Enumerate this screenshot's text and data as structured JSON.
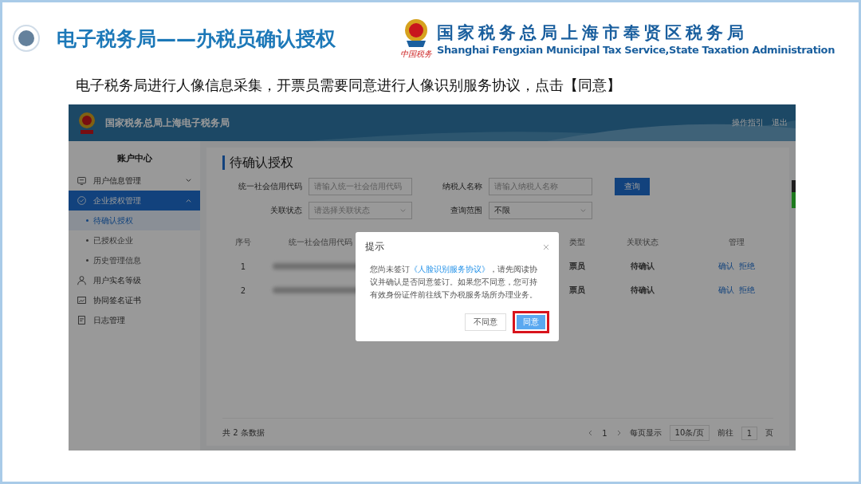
{
  "slide": {
    "title": "电子税务局——办税员确认授权",
    "org_name": "国家税务总局上海市奉贤区税务局",
    "org_name_en": "Shanghai Fengxian Municipal Tax Service,State Taxation Administration",
    "org_seal_text": "中国税务",
    "instruction": "电子税务局进行人像信息采集，开票员需要同意进行人像识别服务协议，点击【同意】"
  },
  "app": {
    "header": {
      "title": "国家税务总局上海电子税务局",
      "links": [
        "操作指引",
        "退出"
      ]
    },
    "sidebar": {
      "title": "账户中心",
      "items": [
        {
          "label": "用户信息管理",
          "kind": "group",
          "expanded": false,
          "selected": false
        },
        {
          "label": "企业授权管理",
          "kind": "group",
          "expanded": true,
          "selected": true,
          "children": [
            {
              "label": "待确认授权",
              "selected": true
            },
            {
              "label": "已授权企业",
              "selected": false
            },
            {
              "label": "历史管理信息",
              "selected": false
            }
          ]
        },
        {
          "label": "用户实名等级",
          "kind": "link",
          "selected": false
        },
        {
          "label": "协同签名证书",
          "kind": "link",
          "selected": false
        },
        {
          "label": "日志管理",
          "kind": "link",
          "selected": false
        }
      ]
    },
    "page": {
      "title": "待确认授权",
      "filters": [
        {
          "label": "统一社会信用代码",
          "kind": "input",
          "placeholder": "请输入统一社会信用代码"
        },
        {
          "label": "纳税人名称",
          "kind": "input",
          "placeholder": "请输入纳税人名称"
        },
        {
          "label": "关联状态",
          "kind": "select",
          "placeholder": "请选择关联状态"
        },
        {
          "label": "查询范围",
          "kind": "select",
          "value": "不限"
        }
      ],
      "query_button": "查询",
      "table": {
        "columns": [
          "序号",
          "统一社会信用代码",
          "类型",
          "关联状态",
          "管理"
        ],
        "rows": [
          {
            "index": "1",
            "type": "票员",
            "status": "待确认",
            "actions": [
              "确认",
              "拒绝"
            ]
          },
          {
            "index": "2",
            "type": "票员",
            "status": "待确认",
            "actions": [
              "确认",
              "拒绝"
            ]
          }
        ]
      },
      "footer": {
        "total": "共 2 条数据",
        "page": "1",
        "page_size_label": "每页显示",
        "page_size": "10条/页",
        "goto_label": "前往",
        "goto_value": "1",
        "goto_suffix": "页"
      }
    },
    "dialog": {
      "title": "提示",
      "body_before": "您尚未签订",
      "link": "《人脸识别服务协议》",
      "body_after": "，请先阅读协议并确认是否同意签订。如果您不同意，您可持有效身份证件前往线下办税服务场所办理业务。",
      "buttons": [
        {
          "label": "不同意",
          "kind": "secondary",
          "highlighted": false
        },
        {
          "label": "同意",
          "kind": "primary",
          "highlighted": true
        }
      ]
    }
  }
}
